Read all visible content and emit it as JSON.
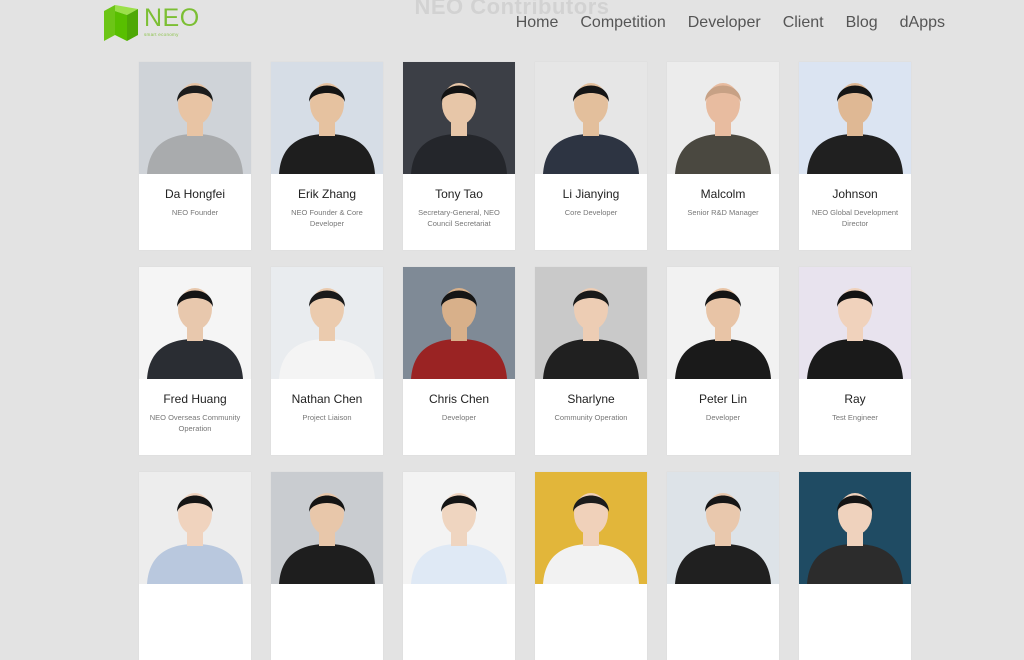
{
  "header": {
    "page_title": "NEO Contributors",
    "logo": {
      "name": "NEO",
      "tagline": "smart economy",
      "color": "#58bf00"
    },
    "nav": [
      "Home",
      "Competition",
      "Developer",
      "Client",
      "Blog",
      "dApps"
    ]
  },
  "contributors": [
    {
      "name": "Da Hongfei",
      "role": "NEO Founder",
      "photo": {
        "bg": "#cfd3d8",
        "skin": "#e8c4a4",
        "hair": "#1c1c1c",
        "top": "#a9abad"
      }
    },
    {
      "name": "Erik Zhang",
      "role": "NEO Founder & Core Developer",
      "photo": {
        "bg": "#d6dde6",
        "skin": "#e6c2a0",
        "hair": "#141414",
        "top": "#1e1e1e"
      }
    },
    {
      "name": "Tony Tao",
      "role": "Secretary-General, NEO Council Secretariat",
      "photo": {
        "bg": "#3c3f46",
        "skin": "#e7c6a8",
        "hair": "#121212",
        "top": "#24262b"
      }
    },
    {
      "name": "Li Jianying",
      "role": "Core Developer",
      "photo": {
        "bg": "#e6e6e6",
        "skin": "#e3bf9c",
        "hair": "#151515",
        "top": "#2d3442"
      }
    },
    {
      "name": "Malcolm",
      "role": "Senior R&D Manager",
      "photo": {
        "bg": "#ececec",
        "skin": "#e8bca0",
        "hair": "#c7a185",
        "top": "#4a4840"
      }
    },
    {
      "name": "Johnson",
      "role": "NEO Global Development Director",
      "photo": {
        "bg": "#dbe4f2",
        "skin": "#dfb894",
        "hair": "#161616",
        "top": "#202020"
      }
    },
    {
      "name": "Fred Huang",
      "role": "NEO Overseas Community Operation",
      "photo": {
        "bg": "#f5f5f5",
        "skin": "#e8c8ad",
        "hair": "#141414",
        "top": "#2a2d33"
      }
    },
    {
      "name": "Nathan Chen",
      "role": "Project Liaison",
      "photo": {
        "bg": "#e9ecef",
        "skin": "#ebcbae",
        "hair": "#1a1a1a",
        "top": "#f4f4f4"
      }
    },
    {
      "name": "Chris Chen",
      "role": "Developer",
      "photo": {
        "bg": "#7f8a96",
        "skin": "#d8b08a",
        "hair": "#151515",
        "top": "#9a2323"
      }
    },
    {
      "name": "Sharlyne",
      "role": "Community Operation",
      "photo": {
        "bg": "#c9c9c9",
        "skin": "#edcdb4",
        "hair": "#1a1a1a",
        "top": "#202020"
      }
    },
    {
      "name": "Peter Lin",
      "role": "Developer",
      "photo": {
        "bg": "#f2f2f2",
        "skin": "#e8c4a6",
        "hair": "#141414",
        "top": "#1a1a1a"
      }
    },
    {
      "name": "Ray",
      "role": "Test Engineer",
      "photo": {
        "bg": "#e8e3ee",
        "skin": "#f0d2bc",
        "hair": "#121212",
        "top": "#1a1a1a"
      }
    },
    {
      "name": "",
      "role": "",
      "photo": {
        "bg": "#ededed",
        "skin": "#f0d3be",
        "hair": "#151515",
        "top": "#b9c8de"
      }
    },
    {
      "name": "",
      "role": "",
      "photo": {
        "bg": "#c9ccd0",
        "skin": "#e8c7aa",
        "hair": "#141414",
        "top": "#1e1e1e"
      }
    },
    {
      "name": "",
      "role": "",
      "photo": {
        "bg": "#f3f3f3",
        "skin": "#efd5c0",
        "hair": "#141414",
        "top": "#dfe9f5"
      }
    },
    {
      "name": "",
      "role": "",
      "photo": {
        "bg": "#e2b63a",
        "skin": "#f0d1ba",
        "hair": "#1c1c1c",
        "top": "#f2f2f2"
      }
    },
    {
      "name": "",
      "role": "",
      "photo": {
        "bg": "#dde3e8",
        "skin": "#e9c8ad",
        "hair": "#161616",
        "top": "#202020"
      }
    },
    {
      "name": "",
      "role": "",
      "photo": {
        "bg": "#1f4b63",
        "skin": "#efd2bd",
        "hair": "#141414",
        "top": "#2c2c2c"
      }
    }
  ]
}
